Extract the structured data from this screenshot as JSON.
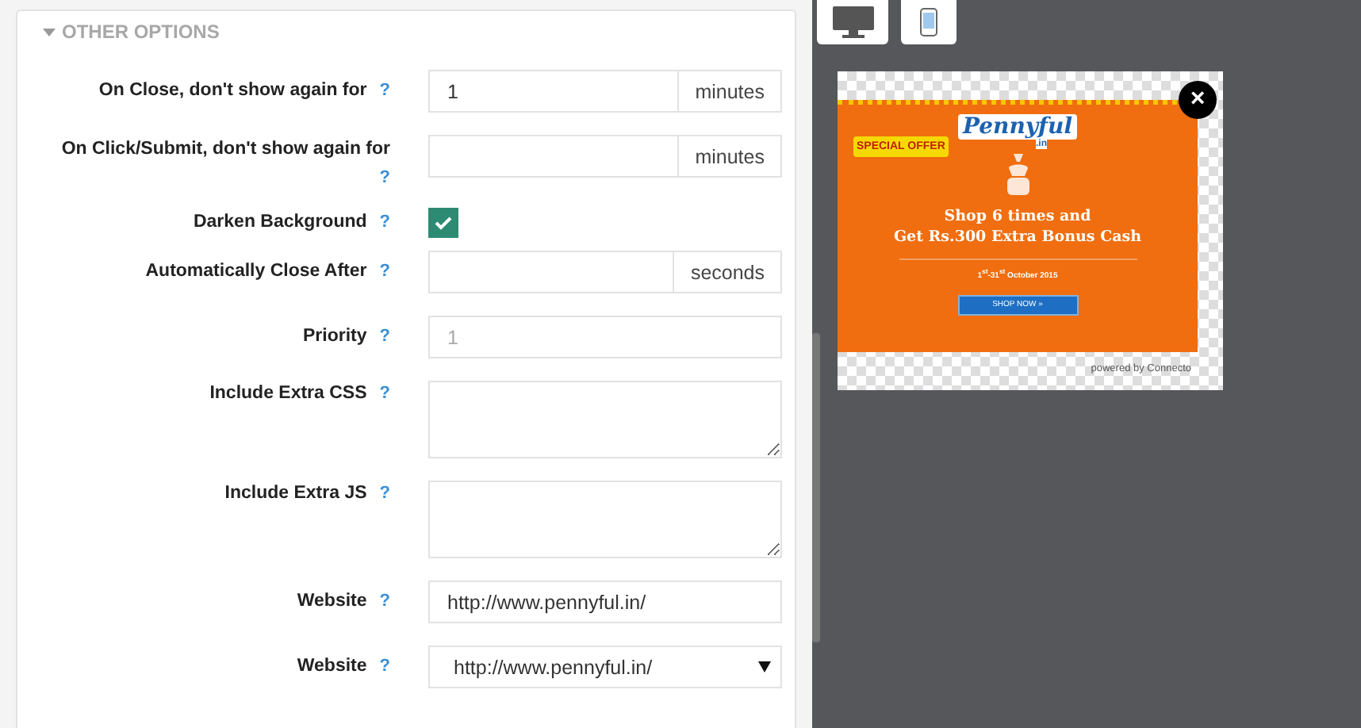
{
  "section": {
    "title": "OTHER OPTIONS",
    "expanded": true
  },
  "fields": [
    {
      "kind": "addon",
      "label": "On Close, don't show again for",
      "help": "?",
      "value": "1",
      "addon": "minutes"
    },
    {
      "kind": "addon",
      "label": "On Click/Submit, don't show again for",
      "help": "?",
      "addon": "minutes"
    },
    {
      "kind": "checkbox",
      "label": "Darken Background",
      "help": "?",
      "checked": true
    },
    {
      "kind": "addon",
      "label": "Automatically Close After",
      "help": "?",
      "addon": "seconds"
    },
    {
      "kind": "text",
      "label": "Priority",
      "help": "?",
      "placeholder": "1"
    },
    {
      "kind": "textarea",
      "label": "Include Extra CSS",
      "help": "?"
    },
    {
      "kind": "textarea",
      "label": "Include Extra JS",
      "help": "?"
    },
    {
      "kind": "text",
      "label": "Website",
      "help": "?",
      "value": "http://www.pennyful.in/"
    },
    {
      "kind": "select",
      "label": "Website",
      "help": "?",
      "value": "http://www.pennyful.in/"
    }
  ],
  "devices": [
    {
      "kind": "desktop"
    },
    {
      "kind": "mobile"
    }
  ],
  "preview": {
    "close": "×",
    "badge": "SPECIAL OFFER",
    "logo": "Pennyful",
    "logo_sub": ".in",
    "headline": "Shop 6 times and",
    "subline": "Get Rs.300 Extra Bonus Cash",
    "dates": "1$^{st}$-31$^{st}$ October 2015",
    "button": "SHOP NOW »",
    "powered": "powered by Connecto"
  }
}
